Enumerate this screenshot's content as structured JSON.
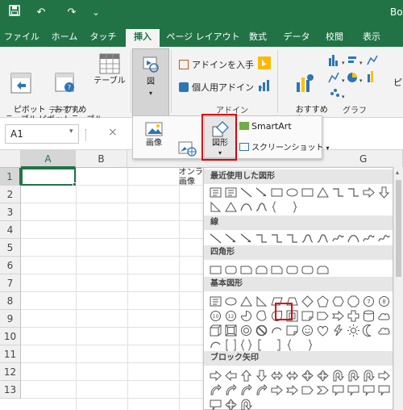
{
  "title_bar": {
    "doc_title": "Boo",
    "undo_label": "↶",
    "redo_label": "↷",
    "customize_label": "⌄"
  },
  "tabs": [
    {
      "label": "ファイル"
    },
    {
      "label": "ホーム"
    },
    {
      "label": "タッチ"
    },
    {
      "label": "挿入",
      "active": true
    },
    {
      "label": "ページ レイアウト"
    },
    {
      "label": "数式"
    },
    {
      "label": "データ"
    },
    {
      "label": "校閲"
    },
    {
      "label": "表示"
    }
  ],
  "ribbon": {
    "table_group": {
      "label": "テーブル",
      "pivot_table": "ピボット\nテーブル",
      "recommended_pivot": "おすすめ\nピボットテーブル",
      "table": "テーブル"
    },
    "illustration_label": "図",
    "addin_group": {
      "label": "アドイン",
      "get_addins": "アドインを入手",
      "my_addins": "個人用アドイン"
    },
    "chart_group": {
      "label": "グラフ",
      "recommended_chart": "おすすめ\nグラフ",
      "partial_right": "ピ"
    }
  },
  "formula_bar": {
    "name_box": "A1",
    "cancel": "×"
  },
  "grid": {
    "columns": [
      "A",
      "B",
      "G"
    ],
    "rows": [
      "1",
      "2",
      "3",
      "4",
      "5",
      "6",
      "7",
      "8",
      "9",
      "10",
      "11",
      "12",
      "13"
    ]
  },
  "picture_menu": {
    "image": "画像",
    "online_image": "オンライン\n画像",
    "shapes": "図形",
    "smartart": "SmartArt",
    "screenshot": "スクリーンショット"
  },
  "shapes_gallery": {
    "sections": [
      {
        "title": "最近使用した図形"
      },
      {
        "title": "線"
      },
      {
        "title": "四角形"
      },
      {
        "title": "基本図形"
      },
      {
        "title": "ブロック矢印"
      }
    ]
  },
  "colors": {
    "accent": "#217346",
    "highlight": "#e00000"
  }
}
